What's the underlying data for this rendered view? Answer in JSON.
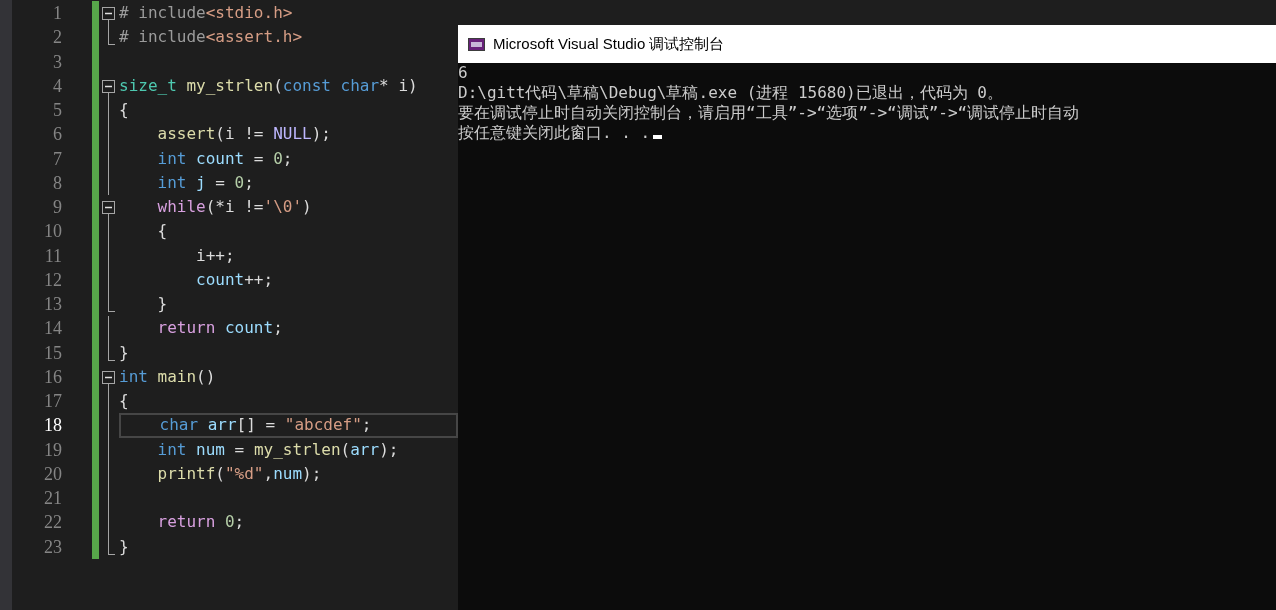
{
  "editor": {
    "lines": [
      {
        "number": "1",
        "current": false,
        "kind": "fold-start",
        "tokens": [
          {
            "kind": "preproc",
            "text": "# include"
          },
          {
            "kind": "string",
            "text": "<stdio.h>"
          }
        ]
      },
      {
        "number": "2",
        "current": false,
        "kind": "fold-end",
        "tokens": [
          {
            "kind": "preproc",
            "text": "# include"
          },
          {
            "kind": "string",
            "text": "<assert.h>"
          }
        ]
      },
      {
        "number": "3",
        "current": false,
        "kind": "plain"
      },
      {
        "number": "4",
        "current": false,
        "kind": "fold-start",
        "tokens": [
          {
            "kind": "type",
            "text": "size_t "
          },
          {
            "kind": "func",
            "text": "my_strlen"
          },
          {
            "kind": "plain",
            "text": "("
          },
          {
            "kind": "keyword",
            "text": "const char"
          },
          {
            "kind": "plain",
            "text": "* i)"
          }
        ]
      },
      {
        "number": "5",
        "current": false,
        "kind": "fold-body",
        "tokens": [
          {
            "kind": "plain",
            "text": "{"
          }
        ]
      },
      {
        "number": "6",
        "current": false,
        "kind": "fold-body",
        "tokens": [
          {
            "kind": "func",
            "text": "    assert"
          },
          {
            "kind": "plain",
            "text": "(i != "
          },
          {
            "kind": "macro",
            "text": "NULL"
          },
          {
            "kind": "plain",
            "text": ");"
          }
        ]
      },
      {
        "number": "7",
        "current": false,
        "kind": "fold-body",
        "tokens": [
          {
            "kind": "keyword",
            "text": "    int "
          },
          {
            "kind": "var",
            "text": "count"
          },
          {
            "kind": "plain",
            "text": " = "
          },
          {
            "kind": "number",
            "text": "0"
          },
          {
            "kind": "plain",
            "text": ";"
          }
        ]
      },
      {
        "number": "8",
        "current": false,
        "kind": "fold-body",
        "tokens": [
          {
            "kind": "keyword",
            "text": "    int "
          },
          {
            "kind": "var",
            "text": "j"
          },
          {
            "kind": "plain",
            "text": " = "
          },
          {
            "kind": "number",
            "text": "0"
          },
          {
            "kind": "plain",
            "text": ";"
          }
        ]
      },
      {
        "number": "9",
        "current": false,
        "kind": "fold-start",
        "tokens": [
          {
            "kind": "control",
            "text": "    while"
          },
          {
            "kind": "plain",
            "text": "(*i !="
          },
          {
            "kind": "string",
            "text": "'\\0'"
          },
          {
            "kind": "plain",
            "text": ")"
          }
        ]
      },
      {
        "number": "10",
        "current": false,
        "kind": "fold-body",
        "tokens": [
          {
            "kind": "plain",
            "text": "    {"
          }
        ]
      },
      {
        "number": "11",
        "current": false,
        "kind": "fold-body",
        "tokens": [
          {
            "kind": "plain",
            "text": "        i++;"
          }
        ]
      },
      {
        "number": "12",
        "current": false,
        "kind": "fold-body",
        "tokens": [
          {
            "kind": "var",
            "text": "        count"
          },
          {
            "kind": "plain",
            "text": "++;"
          }
        ]
      },
      {
        "number": "13",
        "current": false,
        "kind": "fold-end",
        "tokens": [
          {
            "kind": "plain",
            "text": "    }"
          }
        ]
      },
      {
        "number": "14",
        "current": false,
        "kind": "fold-body",
        "tokens": [
          {
            "kind": "control",
            "text": "    return "
          },
          {
            "kind": "var",
            "text": "count"
          },
          {
            "kind": "plain",
            "text": ";"
          }
        ]
      },
      {
        "number": "15",
        "current": false,
        "kind": "fold-end",
        "tokens": [
          {
            "kind": "plain",
            "text": "}"
          }
        ]
      },
      {
        "number": "16",
        "current": false,
        "kind": "fold-start",
        "tokens": [
          {
            "kind": "keyword",
            "text": "int "
          },
          {
            "kind": "func",
            "text": "main"
          },
          {
            "kind": "plain",
            "text": "()"
          }
        ]
      },
      {
        "number": "17",
        "current": false,
        "kind": "fold-body",
        "tokens": [
          {
            "kind": "plain",
            "text": "{"
          }
        ]
      },
      {
        "number": "18",
        "current": true,
        "kind": "fold-body",
        "tokens": [
          {
            "kind": "keyword",
            "text": "    char "
          },
          {
            "kind": "var",
            "text": "arr"
          },
          {
            "kind": "plain",
            "text": "[] = "
          },
          {
            "kind": "string",
            "text": "\"abcdef\""
          },
          {
            "kind": "plain",
            "text": ";"
          }
        ]
      },
      {
        "number": "19",
        "current": false,
        "kind": "fold-body",
        "tokens": [
          {
            "kind": "keyword",
            "text": "    int "
          },
          {
            "kind": "var",
            "text": "num"
          },
          {
            "kind": "plain",
            "text": " = "
          },
          {
            "kind": "func",
            "text": "my_strlen"
          },
          {
            "kind": "plain",
            "text": "("
          },
          {
            "kind": "var",
            "text": "arr"
          },
          {
            "kind": "plain",
            "text": ");"
          }
        ]
      },
      {
        "number": "20",
        "current": false,
        "kind": "fold-body",
        "tokens": [
          {
            "kind": "func",
            "text": "    printf"
          },
          {
            "kind": "plain",
            "text": "("
          },
          {
            "kind": "string",
            "text": "\"%d\""
          },
          {
            "kind": "plain",
            "text": ","
          },
          {
            "kind": "var",
            "text": "num"
          },
          {
            "kind": "plain",
            "text": ");"
          }
        ]
      },
      {
        "number": "21",
        "current": false,
        "kind": "fold-body"
      },
      {
        "number": "22",
        "current": false,
        "kind": "fold-body",
        "tokens": [
          {
            "kind": "control",
            "text": "    return "
          },
          {
            "kind": "number",
            "text": "0"
          },
          {
            "kind": "plain",
            "text": ";"
          }
        ]
      },
      {
        "number": "23",
        "current": false,
        "kind": "fold-end",
        "tokens": [
          {
            "kind": "plain",
            "text": "}"
          }
        ]
      }
    ]
  },
  "console": {
    "title": "Microsoft Visual Studio 调试控制台",
    "output": [
      "6",
      "D:\\gitt代码\\草稿\\Debug\\草稿.exe (进程 15680)已退出，代码为 0。",
      "要在调试停止时自动关闭控制台，请启用“工具”->“选项”->“调试”->“调试停止时自动",
      "按任意键关闭此窗口. . ."
    ]
  }
}
